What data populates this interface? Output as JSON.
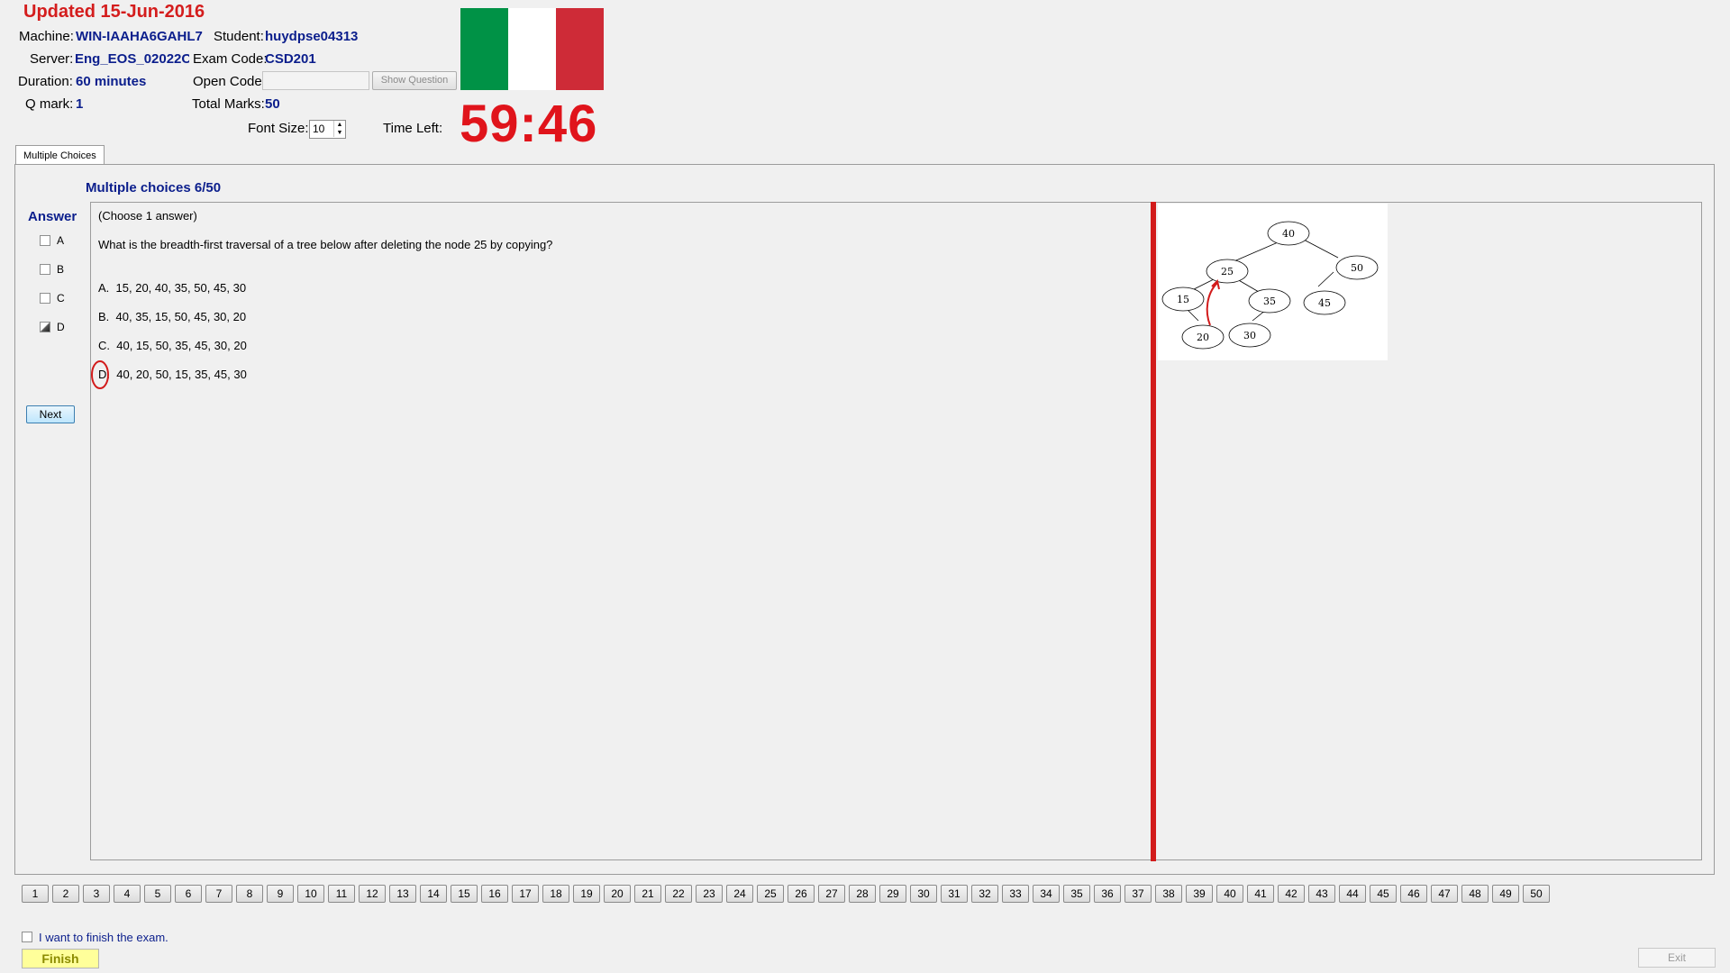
{
  "header": {
    "updated": "Updated 15-Jun-2016",
    "machine_label": "Machine:",
    "machine_value": "WIN-IAAHA6GAHL7",
    "student_label": "Student:",
    "student_value": "huydpse04313",
    "server_label": "Server:",
    "server_value": "Eng_EOS_02022C",
    "exam_code_label": "Exam Code:",
    "exam_code_value": "CSD201",
    "duration_label": "Duration:",
    "duration_value": "60 minutes",
    "open_code_label": "Open Code:",
    "open_code_value": "",
    "show_question_label": "Show Question",
    "qmark_label": "Q mark:",
    "qmark_value": "1",
    "total_marks_label": "Total Marks:",
    "total_marks_value": "50",
    "font_size_label": "Font Size:",
    "font_size_value": "10",
    "time_left_label": "Time Left:",
    "time_left_value": "59:46",
    "flag_colors": [
      "#009246",
      "#ffffff",
      "#ce2b37"
    ]
  },
  "tabs": [
    {
      "label": "Multiple Choices",
      "active": true
    }
  ],
  "question": {
    "title": "Multiple choices 6/50",
    "instruction": "(Choose 1 answer)",
    "text": "What is the breadth-first traversal of a tree below after deleting the node  25  by copying?",
    "options": [
      {
        "letter": "A.",
        "text": "15, 20, 40, 35, 50, 45, 30"
      },
      {
        "letter": "B.",
        "text": "40, 35, 15, 50, 45, 30, 20"
      },
      {
        "letter": "C.",
        "text": "40, 15, 50, 35, 45, 30, 20"
      },
      {
        "letter": "D.",
        "text": "40, 20, 50, 15, 35, 45, 30"
      }
    ],
    "tree_nodes": [
      "40",
      "25",
      "50",
      "15",
      "35",
      "45",
      "20",
      "30"
    ]
  },
  "answer_panel": {
    "label": "Answer",
    "choices": [
      {
        "letter": "A",
        "checked": false
      },
      {
        "letter": "B",
        "checked": false
      },
      {
        "letter": "C",
        "checked": false
      },
      {
        "letter": "D",
        "checked": true
      }
    ],
    "next_label": "Next"
  },
  "nav": {
    "numbers": [
      "1",
      "2",
      "3",
      "4",
      "5",
      "6",
      "7",
      "8",
      "9",
      "10",
      "11",
      "12",
      "13",
      "14",
      "15",
      "16",
      "17",
      "18",
      "19",
      "20",
      "21",
      "22",
      "23",
      "24",
      "25",
      "26",
      "27",
      "28",
      "29",
      "30",
      "31",
      "32",
      "33",
      "34",
      "35",
      "36",
      "37",
      "38",
      "39",
      "40",
      "41",
      "42",
      "43",
      "44",
      "45",
      "46",
      "47",
      "48",
      "49",
      "50"
    ]
  },
  "footer": {
    "finish_checkbox_label": "I want to finish the exam.",
    "finish_label": "Finish",
    "exit_label": "Exit"
  },
  "colors": {
    "accent_blue": "#0b1e8c",
    "timer_red": "#e0141b",
    "annotation_red": "#d21b1b"
  }
}
